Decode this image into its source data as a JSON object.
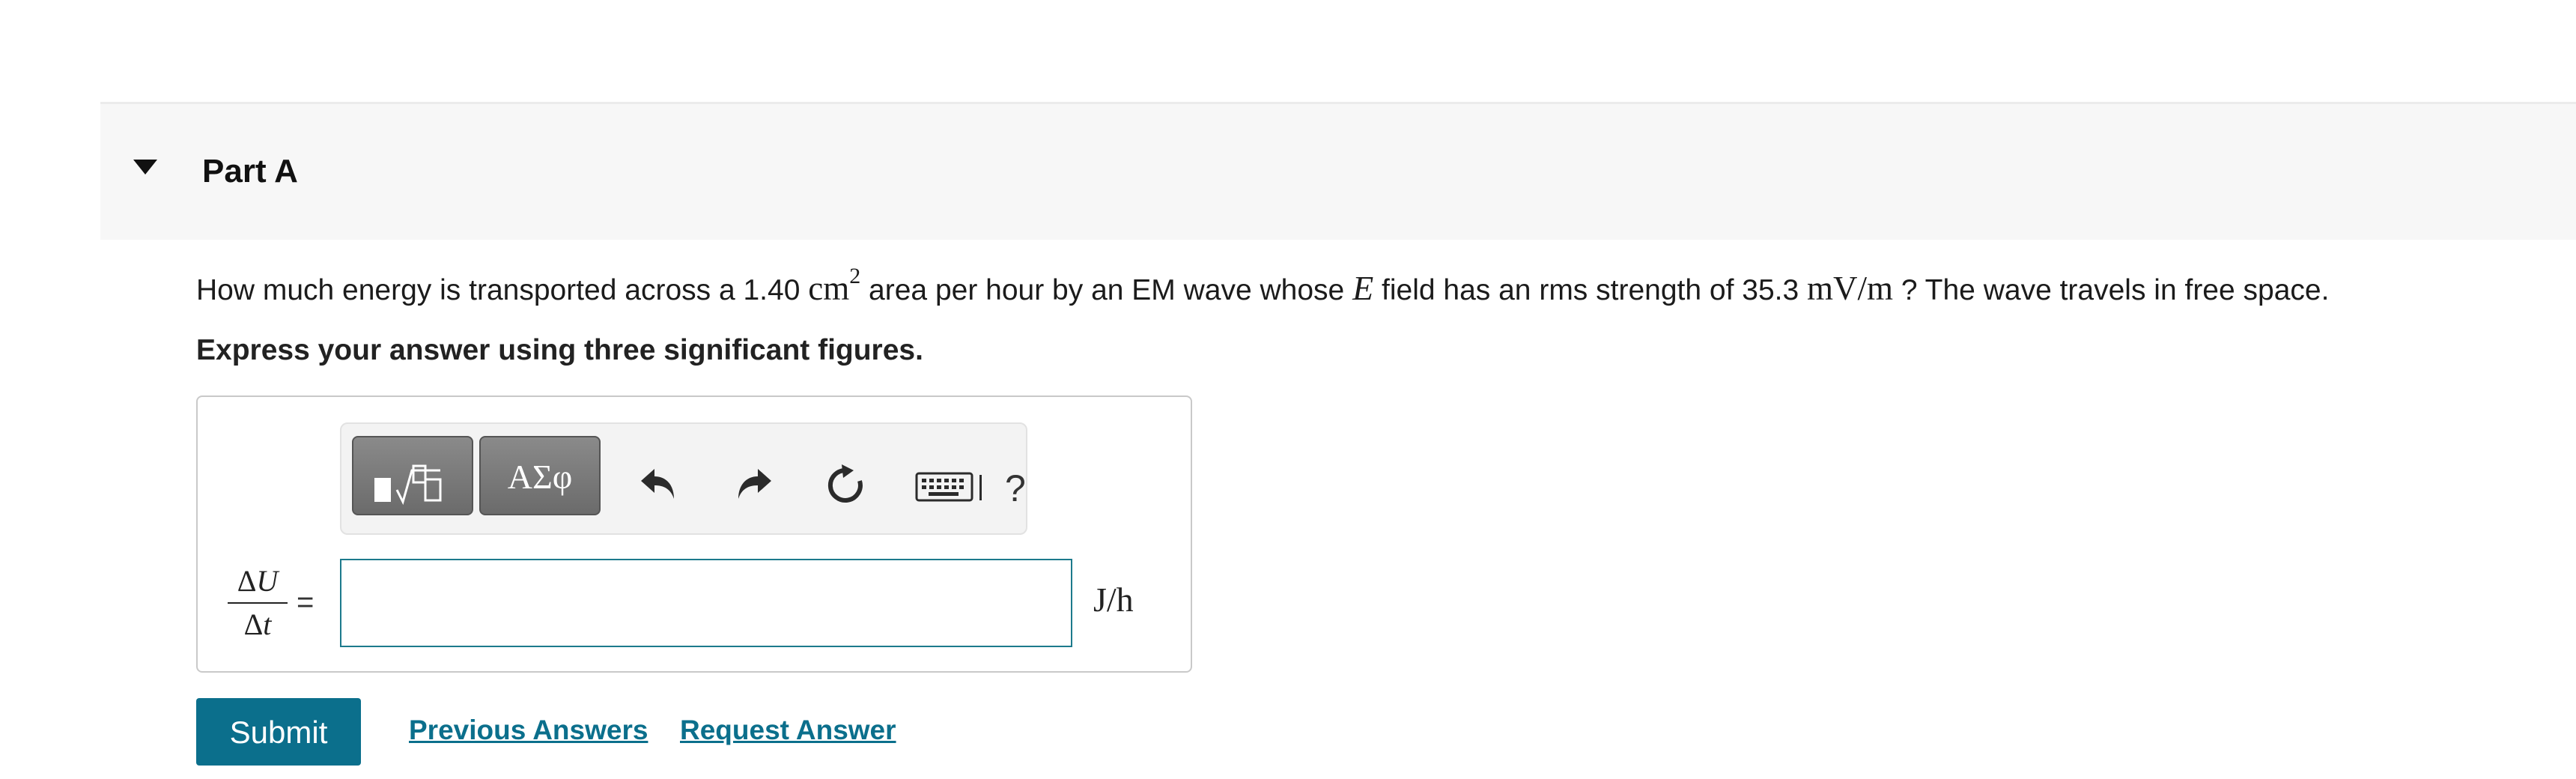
{
  "part": {
    "title": "Part A",
    "toggle_icon": "caret-down-icon"
  },
  "question": {
    "text_1": "How much energy is transported across a 1.40 ",
    "unit_area": "cm",
    "unit_area_exp": "2",
    "text_2": " area per hour by an EM wave whose ",
    "field_symbol": "E",
    "text_3": " field has an rms strength of 35.3 ",
    "unit_field": "mV/m",
    "text_4": " ? The wave travels in free space."
  },
  "instruction": "Express your answer using three significant figures.",
  "toolbar": {
    "templates_icon": "templates-icon",
    "symbols_label": "ΑΣφ",
    "undo_icon": "undo-icon",
    "redo_icon": "redo-icon",
    "reset_icon": "reset-icon",
    "keyboard_icon": "keyboard-icon",
    "help_label": "?"
  },
  "answer": {
    "lhs_numerator_delta": "Δ",
    "lhs_numerator_var": "U",
    "lhs_denominator_delta": "Δ",
    "lhs_denominator_var": "t",
    "equals": "=",
    "value": "",
    "unit": "J/h"
  },
  "actions": {
    "submit_label": "Submit",
    "previous_answers_label": "Previous Answers",
    "request_answer_label": "Request Answer"
  },
  "colors": {
    "accent": "#0b6f8c",
    "input_border": "#1c7a8c",
    "header_band": "#f7f7f7"
  }
}
